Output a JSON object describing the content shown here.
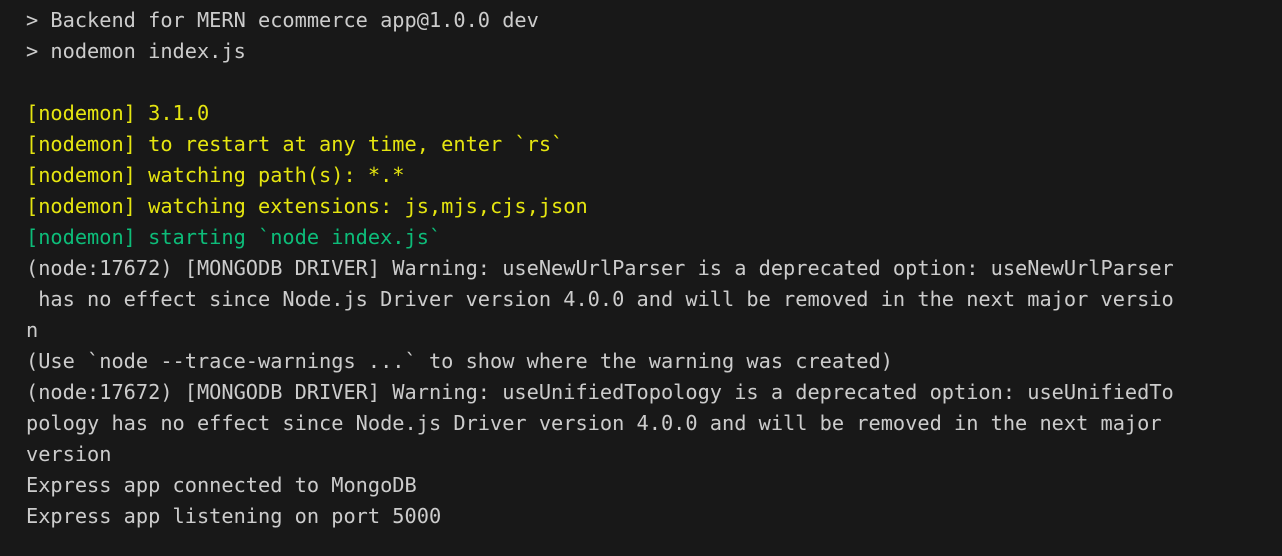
{
  "terminal": {
    "lines": [
      {
        "text": "> Backend for MERN ecommerce app@1.0.0 dev",
        "color": "#cccccc"
      },
      {
        "text": "> nodemon index.js",
        "color": "#cccccc"
      },
      {
        "text": "",
        "color": "#cccccc"
      },
      {
        "text": "[nodemon] 3.1.0",
        "color": "#e5e510"
      },
      {
        "text": "[nodemon] to restart at any time, enter `rs`",
        "color": "#e5e510"
      },
      {
        "text": "[nodemon] watching path(s): *.*",
        "color": "#e5e510"
      },
      {
        "text": "[nodemon] watching extensions: js,mjs,cjs,json",
        "color": "#e5e510"
      },
      {
        "text": "[nodemon] starting `node index.js`",
        "color": "#0dbc79"
      },
      {
        "text": "(node:17672) [MONGODB DRIVER] Warning: useNewUrlParser is a deprecated option: useNewUrlParser",
        "color": "#cccccc"
      },
      {
        "text": " has no effect since Node.js Driver version 4.0.0 and will be removed in the next major versio",
        "color": "#cccccc"
      },
      {
        "text": "n",
        "color": "#cccccc"
      },
      {
        "text": "(Use `node --trace-warnings ...` to show where the warning was created)",
        "color": "#cccccc"
      },
      {
        "text": "(node:17672) [MONGODB DRIVER] Warning: useUnifiedTopology is a deprecated option: useUnifiedTo",
        "color": "#cccccc"
      },
      {
        "text": "pology has no effect since Node.js Driver version 4.0.0 and will be removed in the next major",
        "color": "#cccccc"
      },
      {
        "text": "version",
        "color": "#cccccc"
      },
      {
        "text": "Express app connected to MongoDB",
        "color": "#cccccc"
      },
      {
        "text": "Express app listening on port 5000",
        "color": "#cccccc"
      }
    ]
  }
}
